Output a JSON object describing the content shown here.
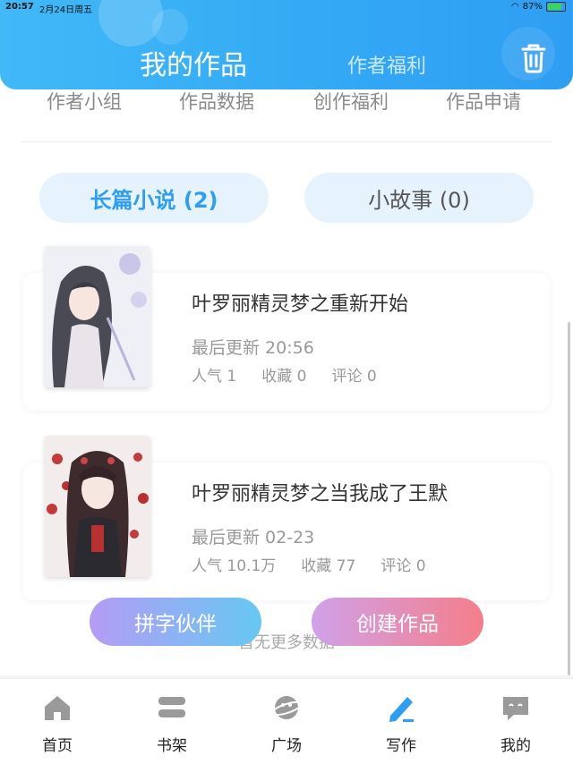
{
  "status_bar": {
    "time": "20:57",
    "date": "2月24日周五",
    "battery": "87%"
  },
  "header": {
    "title": "我的作品",
    "subtitle": "作者福利"
  },
  "quick_links": [
    "作者小组",
    "作品数据",
    "创作福利",
    "作品申请"
  ],
  "tabs": [
    {
      "label": "长篇小说 (2)",
      "active": true
    },
    {
      "label": "小故事 (0)",
      "active": false
    }
  ],
  "works": [
    {
      "title": "叶罗丽精灵梦之重新开始",
      "updated": "最后更新 20:56",
      "popularity": "人气 1",
      "favorites": "收藏 0",
      "comments": "评论 0"
    },
    {
      "title": "叶罗丽精灵梦之当我成了王默",
      "updated": "最后更新 02-23",
      "popularity": "人气 10.1万",
      "favorites": "收藏 77",
      "comments": "评论 0"
    }
  ],
  "no_more": "暂无更多数据",
  "buttons": {
    "partner": "拼字伙伴",
    "create": "创建作品"
  },
  "nav": [
    "首页",
    "书架",
    "广场",
    "写作",
    "我的"
  ],
  "colors": {
    "accent": "#2e9ef3",
    "create_button_end": "#f57e8a",
    "partner_button_start": "#b49cf4"
  }
}
